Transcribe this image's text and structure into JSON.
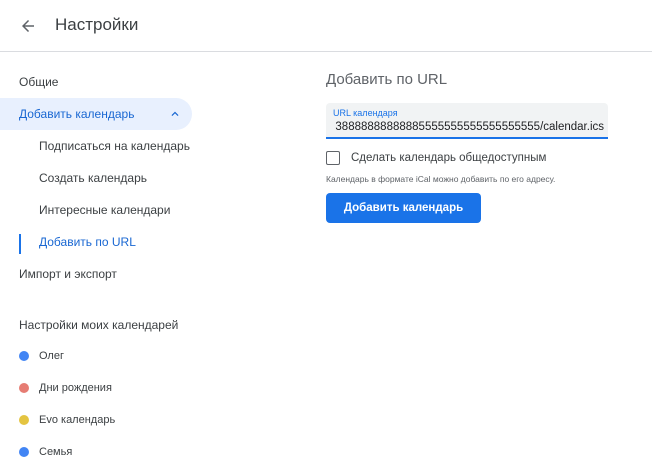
{
  "header": {
    "title": "Настройки",
    "back_icon": "arrow-back-icon"
  },
  "sidebar": {
    "general": "Общие",
    "add_calendar": "Добавить календарь",
    "sub_items": [
      "Подписаться на календарь",
      "Создать календарь",
      "Интересные календари",
      "Добавить по URL"
    ],
    "import_export": "Импорт и экспорт",
    "my_calendars_heading": "Настройки моих календарей",
    "calendars": [
      {
        "name": "Олег",
        "color": "#4285f4"
      },
      {
        "name": "Дни рождения",
        "color": "#e67c73"
      },
      {
        "name": "Evo календарь",
        "color": "#e4c441"
      },
      {
        "name": "Семья",
        "color": "#4285f4"
      }
    ]
  },
  "main": {
    "title": "Добавить по URL",
    "url_label": "URL календаря",
    "url_value": "38888888888885555555555555555555/calendar.ics",
    "public_checkbox_label": "Сделать календарь общедоступным",
    "help_text": "Календарь в формате iCal можно добавить по его адресу.",
    "add_button": "Добавить календарь"
  },
  "colors": {
    "accent": "#1a73e8",
    "active_bg": "#e8f0fe",
    "active_text": "#1967d2"
  }
}
